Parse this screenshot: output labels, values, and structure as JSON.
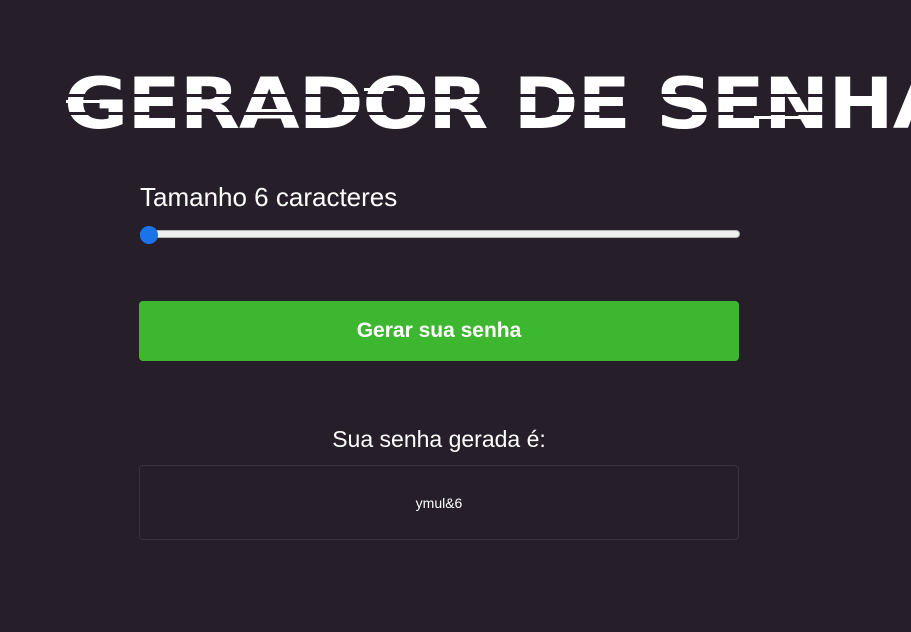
{
  "header": {
    "logo_text": "GERADOR DE SENHA"
  },
  "slider": {
    "label": "Tamanho 6 caracteres",
    "value": 6,
    "min": 6,
    "max": 32
  },
  "generate_button": {
    "label": "Gerar sua senha"
  },
  "result": {
    "title": "Sua senha gerada é:",
    "password": "ymul&6"
  },
  "colors": {
    "background": "#261e28",
    "accent_green": "#3cb72f",
    "slider_thumb": "#1a73e8",
    "text": "#ffffff"
  }
}
